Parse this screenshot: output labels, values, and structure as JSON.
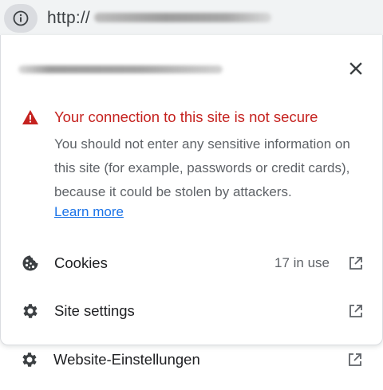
{
  "omnibox": {
    "url_prefix": "http://",
    "info_icon": "info-circle-icon"
  },
  "popup": {
    "close_icon": "close-icon",
    "warning": {
      "icon": "warning-triangle-icon",
      "title": "Your connection to this site is not secure",
      "body": "You should not enter any sensitive information on this site (for example, passwords or credit cards), because it could be stolen by attackers.",
      "link": "Learn more",
      "color": "#c5221f"
    },
    "rows": [
      {
        "icon": "cookie-icon",
        "label": "Cookies",
        "count": "17 in use",
        "action_icon": "open-external-icon"
      },
      {
        "icon": "gear-icon",
        "label": "Site settings",
        "action_icon": "open-external-icon"
      }
    ]
  },
  "extra_row": {
    "icon": "gear-icon",
    "label": "Website-Einstellungen",
    "action_icon": "open-external-icon"
  },
  "colors": {
    "accent_link": "#1a73e8",
    "danger": "#c5221f",
    "secondary_text": "#5f6368",
    "omnibox_bg": "#f1f3f4"
  }
}
